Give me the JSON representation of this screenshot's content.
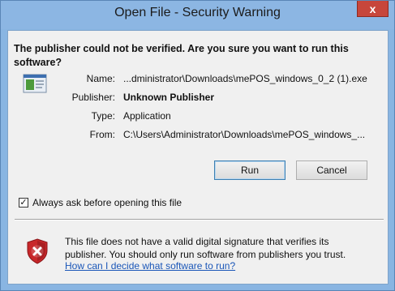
{
  "window": {
    "title": "Open File - Security Warning",
    "close_label": "x"
  },
  "dialog": {
    "headline": "The publisher could not be verified.  Are you sure you want to run this software?",
    "fields": [
      {
        "label": "Name:",
        "value": "...dministrator\\Downloads\\mePOS_windows_0_2 (1).exe"
      },
      {
        "label": "Publisher:",
        "value": "Unknown Publisher"
      },
      {
        "label": "Type:",
        "value": "Application"
      },
      {
        "label": "From:",
        "value": "C:\\Users\\Administrator\\Downloads\\mePOS_windows_..."
      }
    ],
    "buttons": {
      "run": "Run",
      "cancel": "Cancel"
    },
    "checkbox": {
      "label": "Always ask before opening this file",
      "checked": true,
      "check_glyph": "✓"
    },
    "warning": {
      "text": "This file does not have a valid digital signature that verifies its publisher.  You should only run software from publishers you trust.",
      "link": "How can I decide what software to run?"
    }
  },
  "icons": {
    "file": "application-file-icon",
    "shield": "security-shield-error-icon"
  },
  "colors": {
    "titlebar": "#8cb6e3",
    "close_button": "#c7463b",
    "link": "#1a56b8",
    "shield_red": "#c8282a"
  }
}
